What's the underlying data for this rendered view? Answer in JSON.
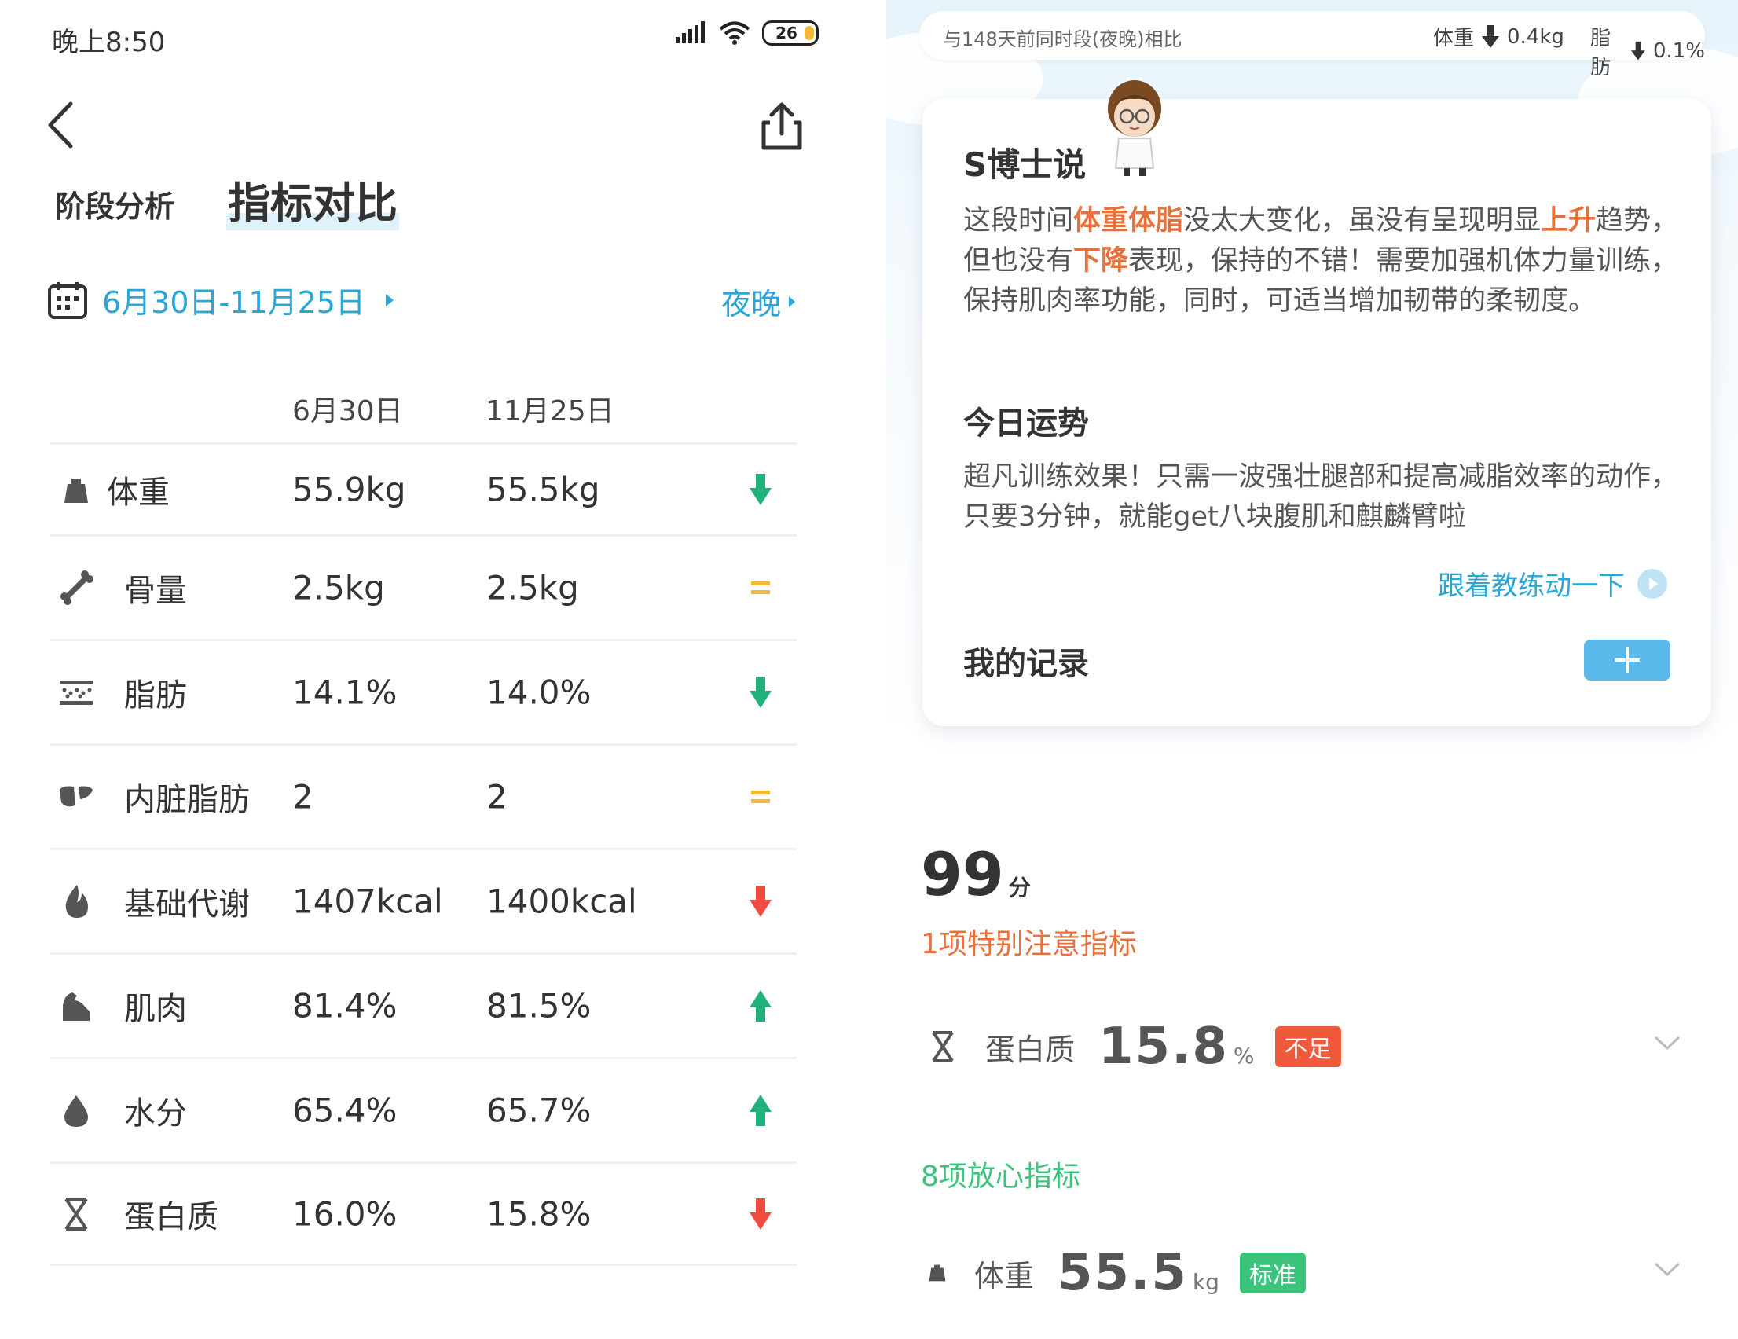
{
  "status": {
    "time": "晚上8:50",
    "battery": "26"
  },
  "header": {
    "tab_stage": "阶段分析",
    "tab_compare": "指标对比"
  },
  "date_row": {
    "range": "6月30日-11月25日",
    "period": "夜晚"
  },
  "table": {
    "col1": "6月30日",
    "col2": "11月25日",
    "rows": [
      {
        "icon": "weight-icon",
        "label": "体重",
        "v1": "55.9kg",
        "v2": "55.5kg",
        "trend": "down",
        "trend_color": "#22b07d"
      },
      {
        "icon": "bone-icon",
        "label": "骨量",
        "v1": "2.5kg",
        "v2": "2.5kg",
        "trend": "equal",
        "trend_color": "#f5b93a"
      },
      {
        "icon": "fat-icon",
        "label": "脂肪",
        "v1": "14.1%",
        "v2": "14.0%",
        "trend": "down",
        "trend_color": "#22b07d"
      },
      {
        "icon": "visceral-fat-icon",
        "label": "内脏脂肪",
        "v1": "2",
        "v2": "2",
        "trend": "equal",
        "trend_color": "#f5b93a"
      },
      {
        "icon": "flame-icon",
        "label": "基础代谢",
        "v1": "1407kcal",
        "v2": "1400kcal",
        "trend": "down",
        "trend_color": "#ef4b3e"
      },
      {
        "icon": "muscle-icon",
        "label": "肌肉",
        "v1": "81.4%",
        "v2": "81.5%",
        "trend": "up",
        "trend_color": "#22b07d"
      },
      {
        "icon": "water-drop-icon",
        "label": "水分",
        "v1": "65.4%",
        "v2": "65.7%",
        "trend": "up",
        "trend_color": "#22b07d"
      },
      {
        "icon": "protein-dna-icon",
        "label": "蛋白质",
        "v1": "16.0%",
        "v2": "15.8%",
        "trend": "down",
        "trend_color": "#ef4b3e"
      }
    ]
  },
  "compare_bar": {
    "text": "与148天前同时段(夜晚)相比",
    "weight_label": "体重",
    "weight_value": "0.4kg",
    "fat_label": "脂肪",
    "fat_value": "0.1%"
  },
  "card": {
    "title": "S博士说",
    "advice": {
      "p1": "这段时间",
      "h1": "体重体脂",
      "p2": "没太大变化，虽没有呈现明显",
      "h2": "上升",
      "p3": "趋势，但也没有",
      "h3": "下降",
      "p4": "表现，保持的不错！需要加强机体力量训练，保持肌肉率功能，同时，可适当增加韧带的柔韧度。"
    },
    "fortune_title": "今日运势",
    "fortune_text": "超凡训练效果！只需一波强壮腿部和提高减脂效率的动作，只要3分钟，就能get八块腹肌和麒麟臂啦",
    "coach_link": "跟着教练动一下",
    "records_title": "我的记录"
  },
  "score": {
    "value": "99",
    "unit": "分"
  },
  "attention_title": "1项特别注意指标",
  "attention_item": {
    "label": "蛋白质",
    "value": "15.8",
    "unit": "%",
    "badge": "不足",
    "badge_color": "#ef5a3c"
  },
  "safe_title": "8项放心指标",
  "safe_item": {
    "label": "体重",
    "value": "55.5",
    "unit": "kg",
    "badge": "标准",
    "badge_color": "#3cc47c"
  }
}
